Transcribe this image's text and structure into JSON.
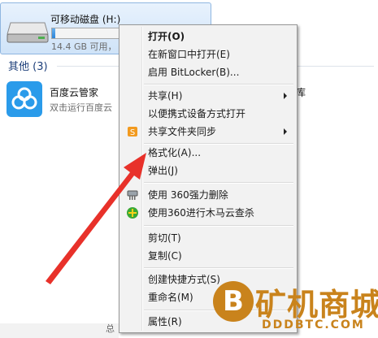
{
  "drive": {
    "name": "可移动磁盘 (H:)",
    "free_text": "14.4 GB 可用，",
    "fill_fraction": 0.02,
    "icon": "removable-drive-icon"
  },
  "group": {
    "title": "其他 (3)"
  },
  "app": {
    "name": "百度云管家",
    "desc": "双击运行百度云",
    "icon": "baidu-cloud-icon"
  },
  "right_peek": "库",
  "bottom_peek": "总",
  "menu": {
    "items": [
      {
        "label": "打开(O)",
        "bold": true
      },
      {
        "label": "在新窗口中打开(E)"
      },
      {
        "label": "启用 BitLocker(B)..."
      },
      {
        "label": "共享(H)",
        "submenu": true
      },
      {
        "label": "以便携式设备方式打开"
      },
      {
        "label": "共享文件夹同步",
        "submenu": true,
        "icon": "sync-folder-icon"
      },
      {
        "label": "格式化(A)..."
      },
      {
        "label": "弹出(J)"
      },
      {
        "label": "使用 360强力删除",
        "icon": "shredder-icon"
      },
      {
        "label": "使用360进行木马云查杀",
        "icon": "360-security-icon"
      },
      {
        "label": "剪切(T)"
      },
      {
        "label": "复制(C)"
      },
      {
        "label": "创建快捷方式(S)"
      },
      {
        "label": "重命名(M)"
      },
      {
        "label": "属性(R)"
      }
    ]
  },
  "watermark": {
    "coin": "B",
    "title": "矿机商城",
    "sub": "DDDBTC.COM"
  },
  "colors": {
    "arrow": "#e8312a",
    "menu_bg": "#f2f2f2",
    "accent": "#2c84d8",
    "watermark": "#c9831c"
  }
}
